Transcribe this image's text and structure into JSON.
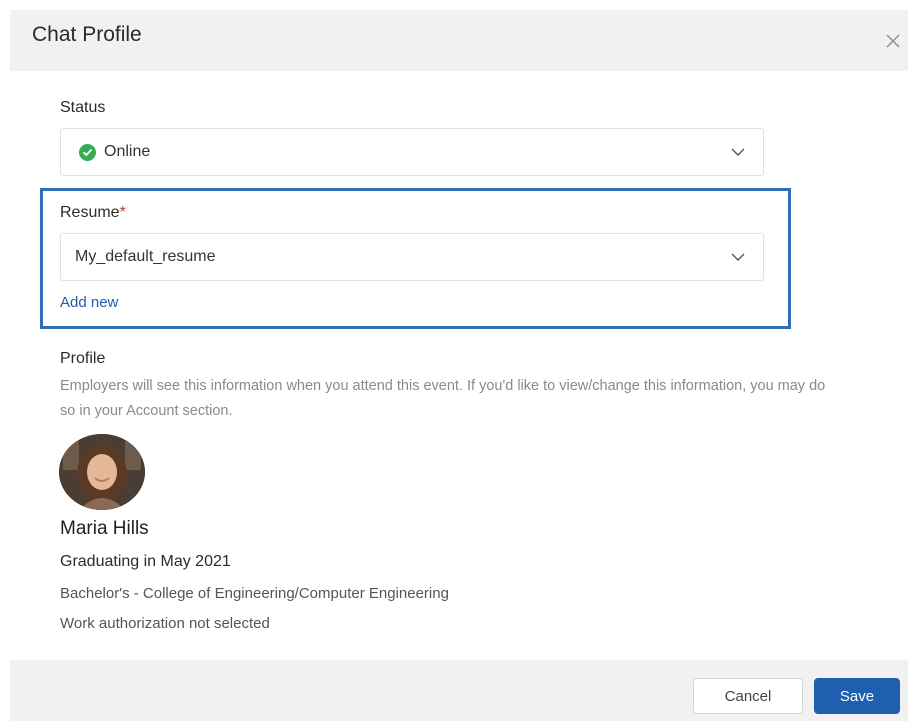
{
  "dialog": {
    "title": "Chat Profile",
    "close_icon": "close-icon"
  },
  "status": {
    "label": "Status",
    "value": "Online",
    "status_color": "#3aaa55"
  },
  "resume": {
    "label": "Resume",
    "required_marker": "*",
    "value": "My_default_resume",
    "add_new_label": "Add new",
    "highlight_color": "#2f6fb3"
  },
  "profile": {
    "label": "Profile",
    "helper_text": "Employers will see this information when you attend this event. If you'd like to view/change this information, you may do so in your Account section.",
    "name": "Maria Hills",
    "graduation": "Graduating in May 2021",
    "degree": "Bachelor's - College of Engineering/Computer Engineering",
    "work_authorization": "Work authorization not selected"
  },
  "footer": {
    "cancel_label": "Cancel",
    "save_label": "Save",
    "accent_color": "#1f5fb0"
  }
}
